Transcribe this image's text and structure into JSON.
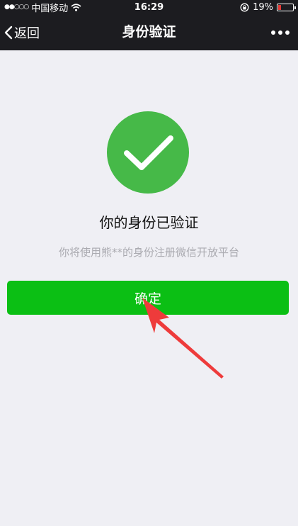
{
  "status_bar": {
    "carrier": "中国移动",
    "time": "16:29",
    "battery": "19%",
    "battery_level": 0.19,
    "battery_color": "#e53935"
  },
  "nav": {
    "back_label": "返回",
    "title": "身份验证",
    "more_icon": "more-dots-icon"
  },
  "main": {
    "success_icon": "checkmark-circle-icon",
    "success_color": "#46b948",
    "title": "你的身份已验证",
    "subtitle": "你将使用熊**的身份注册微信开放平台",
    "confirm_label": "确定",
    "confirm_color": "#0bbf14"
  },
  "annotation": {
    "icon": "red-arrow-icon",
    "color": "#ee3b3b"
  }
}
